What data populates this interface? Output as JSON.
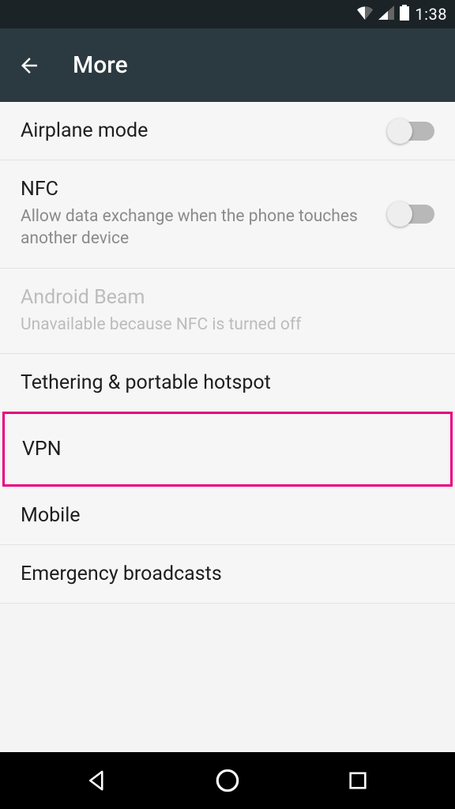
{
  "status_bar": {
    "time": "1:38"
  },
  "app_bar": {
    "title": "More"
  },
  "items": [
    {
      "title": "Airplane mode",
      "subtitle": "",
      "has_switch": true,
      "switch_on": false,
      "disabled": false,
      "highlight": false
    },
    {
      "title": "NFC",
      "subtitle": "Allow data exchange when the phone touches another device",
      "has_switch": true,
      "switch_on": false,
      "disabled": false,
      "highlight": false
    },
    {
      "title": "Android Beam",
      "subtitle": "Unavailable because NFC is turned off",
      "has_switch": false,
      "switch_on": false,
      "disabled": true,
      "highlight": false
    },
    {
      "title": "Tethering & portable hotspot",
      "subtitle": "",
      "has_switch": false,
      "switch_on": false,
      "disabled": false,
      "highlight": false
    },
    {
      "title": "VPN",
      "subtitle": "",
      "has_switch": false,
      "switch_on": false,
      "disabled": false,
      "highlight": true
    },
    {
      "title": "Mobile",
      "subtitle": "",
      "has_switch": false,
      "switch_on": false,
      "disabled": false,
      "highlight": false
    },
    {
      "title": "Emergency broadcasts",
      "subtitle": "",
      "has_switch": false,
      "switch_on": false,
      "disabled": false,
      "highlight": false
    }
  ]
}
